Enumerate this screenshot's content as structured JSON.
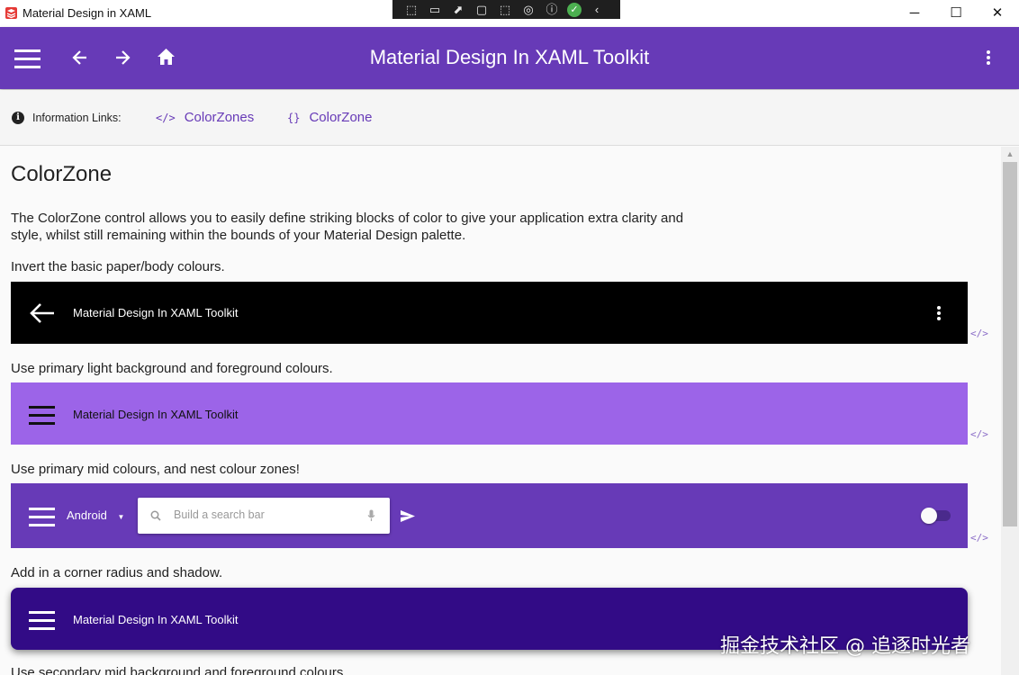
{
  "window": {
    "title": "Material Design in XAML",
    "controls": {
      "minimize": "─",
      "maximize": "☐",
      "close": "✕"
    }
  },
  "debug_toolbar": {
    "icons": [
      "select-element-icon",
      "video-icon",
      "pointer-icon",
      "frame-icon",
      "track-focus-icon",
      "accessibility-check-icon",
      "accessibility-icon",
      "check-icon",
      "collapse-icon"
    ]
  },
  "appbar": {
    "title": "Material Design In XAML Toolkit",
    "background": "#673ab7",
    "icons": [
      "menu-icon",
      "back-arrow-icon",
      "forward-arrow-icon",
      "home-icon",
      "more-vert-icon"
    ]
  },
  "info": {
    "label": "Information Links:",
    "links": [
      {
        "icon": "</>",
        "label": "ColorZones"
      },
      {
        "icon": "{}",
        "label": "ColorZone"
      }
    ]
  },
  "content": {
    "heading": "ColorZone",
    "intro_line1": "The ColorZone control allows you to easily define striking blocks of color to give your application extra clarity and",
    "intro_line2": "style, whilst still remaining within the bounds of your Material Design palette.",
    "sections": [
      {
        "caption": "Invert the basic paper/body colours.",
        "title": "Material Design In XAML Toolkit",
        "bg": "#000000",
        "fg": "#ffffff"
      },
      {
        "caption": "Use primary light background and foreground colours.",
        "title": "Material Design In XAML Toolkit",
        "bg": "#9c64e8",
        "fg": "#111111"
      },
      {
        "caption": "Use primary mid colours, and nest colour zones!",
        "dropdown": "Android",
        "search_placeholder": "Build a search bar",
        "bg": "#673ab7",
        "fg": "#ffffff"
      },
      {
        "caption": "Add in a corner radius and shadow.",
        "title": "Material Design In XAML Toolkit",
        "bg": "#320b86",
        "fg": "#ffffff"
      },
      {
        "caption": "Use secondary mid background and foreground colours"
      }
    ],
    "code_link": "</>"
  },
  "watermark": "掘金技术社区 @ 追逐时光者"
}
